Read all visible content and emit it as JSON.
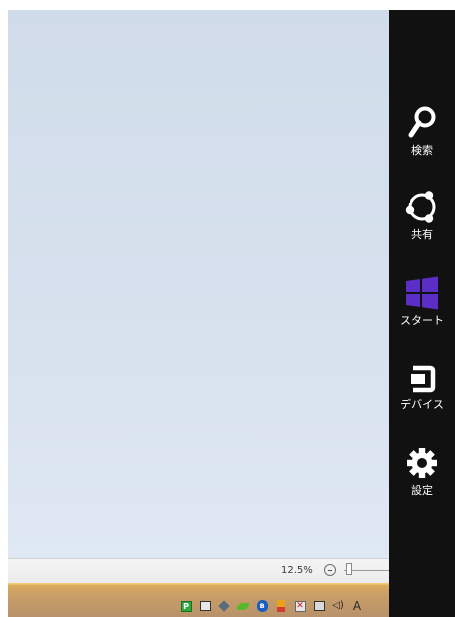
{
  "status_bar": {
    "zoom_level": "12.5%",
    "zoom_slider_position": 0.05
  },
  "taskbar": {
    "tray_icons": [
      {
        "name": "green-app-icon",
        "glyph": "P"
      },
      {
        "name": "network-icon"
      },
      {
        "name": "diamond-app-icon"
      },
      {
        "name": "nvidia-icon"
      },
      {
        "name": "bluetooth-icon",
        "glyph": "ʙ"
      },
      {
        "name": "flag-icon"
      },
      {
        "name": "action-center-icon",
        "glyph": "✕"
      },
      {
        "name": "monitor-icon"
      },
      {
        "name": "speaker-icon",
        "glyph": "◁)"
      },
      {
        "name": "ime-icon",
        "glyph": "A"
      }
    ]
  },
  "charms": {
    "search": {
      "label": "検索"
    },
    "share": {
      "label": "共有"
    },
    "start": {
      "label": "スタート"
    },
    "devices": {
      "label": "デバイス"
    },
    "settings": {
      "label": "設定"
    }
  },
  "colors": {
    "charms_bg": "#111111",
    "start_tile": "#5a2ec7",
    "desktop_bg": "#d7e1ee",
    "taskbar": "#c79d68"
  }
}
